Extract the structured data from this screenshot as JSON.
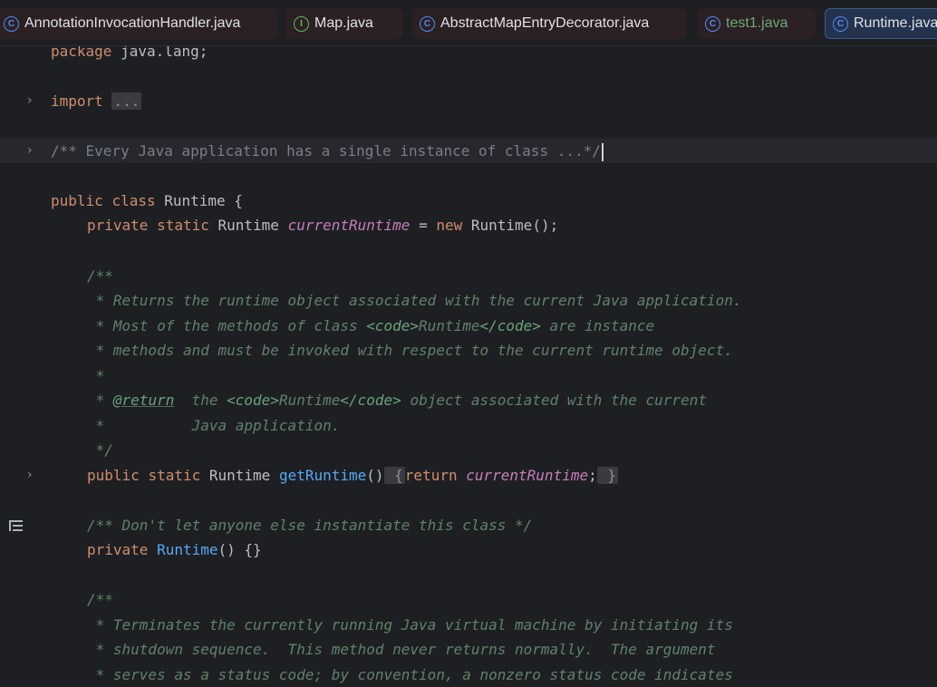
{
  "tabs": [
    {
      "label": "AnnotationInvocationHandler.java",
      "icon": "class-icon",
      "glyph": "C"
    },
    {
      "label": "Map.java",
      "icon": "interface-icon",
      "glyph": "I"
    },
    {
      "label": "AbstractMapEntryDecorator.java",
      "icon": "abstract-class-icon",
      "glyph": "C"
    },
    {
      "label": "test1.java",
      "icon": "class-run-icon",
      "glyph": "C"
    },
    {
      "label": "Runtime.java",
      "icon": "class-icon",
      "glyph": "C",
      "active": true
    }
  ],
  "code": {
    "l1": {
      "kw": "package",
      "rest": " java.lang;"
    },
    "l3": {
      "kw": "import",
      "fold": "..."
    },
    "l5": {
      "text": "/** Every Java application has a single instance of class ...*/"
    },
    "l7": {
      "kw1": "public",
      "kw2": "class",
      "rest": " Runtime {"
    },
    "l8": {
      "kw1": "private",
      "kw2": "static",
      "type": " Runtime ",
      "field": "currentRuntime",
      "eq": " = ",
      "kwnew": "new",
      "rest": " Runtime();"
    },
    "l10": {
      "text": "/**"
    },
    "l11": {
      "text": " * Returns the runtime object associated with the current Java application."
    },
    "l12": {
      "a": " * Most of the methods of class ",
      "tag1": "<code>",
      "mid": "Runtime",
      "tag2": "</code>",
      "b": " are instance"
    },
    "l13": {
      "text": " * methods and must be invoked with respect to the current runtime object."
    },
    "l14": {
      "text": " *"
    },
    "l15": {
      "a": " * ",
      "doctag": "@return",
      "b": "  the ",
      "tag1": "<code>",
      "mid": "Runtime",
      "tag2": "</code>",
      "c": " object associated with the current"
    },
    "l16": {
      "text": " *          Java application."
    },
    "l17": {
      "text": " */"
    },
    "l18": {
      "kw1": "public",
      "kw2": "static",
      "type": " Runtime ",
      "fn": "getRuntime",
      "paren": "()",
      "brace1": " {",
      "kwret": "return",
      "field": "currentRuntime",
      "semi": ";",
      "brace2": " }"
    },
    "l20": {
      "text": "/** Don't let anyone else instantiate this class */"
    },
    "l21": {
      "kw": "private",
      "fn": "Runtime",
      "rest": "() {}"
    },
    "l23": {
      "text": "/**"
    },
    "l24": {
      "text": " * Terminates the currently running Java virtual machine by initiating its"
    },
    "l25": {
      "text": " * shutdown sequence.  This method never returns normally.  The argument"
    },
    "l26": {
      "text": " * serves as a status code; by convention, a nonzero status code indicates"
    }
  },
  "fold_glyph": "›"
}
